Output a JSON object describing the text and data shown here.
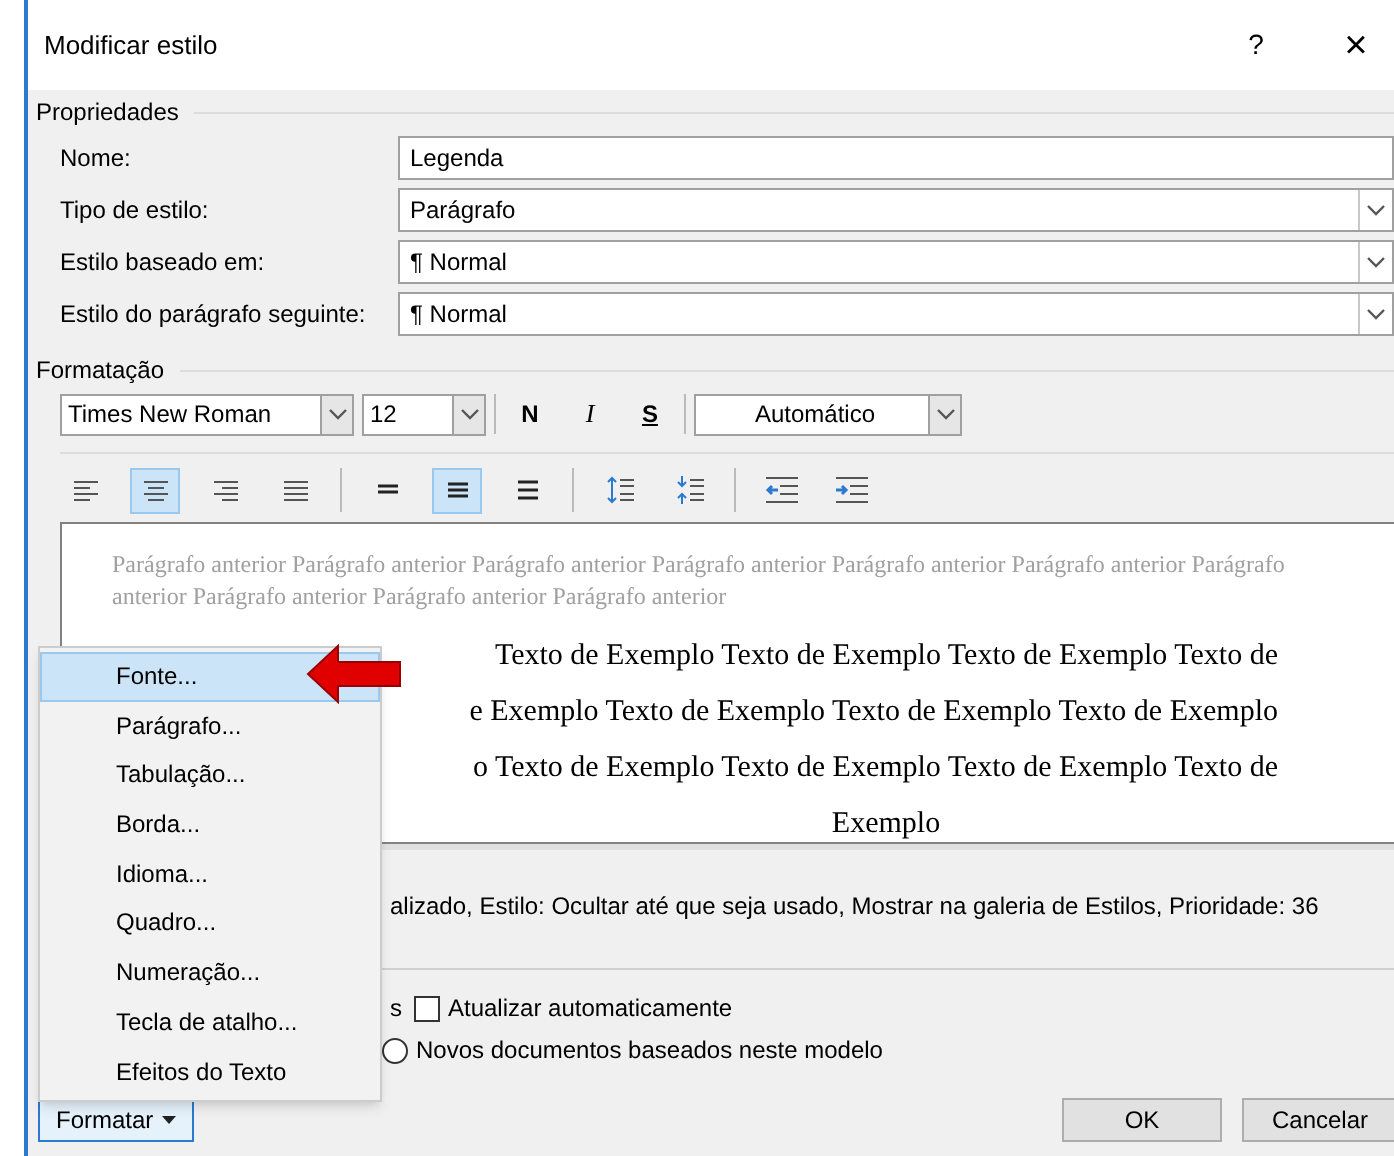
{
  "window": {
    "title": "Modificar estilo",
    "help": "?",
    "close": "×"
  },
  "properties": {
    "heading": "Propriedades",
    "rows": [
      {
        "label": "Nome:",
        "value": "Legenda",
        "kind": "text"
      },
      {
        "label": "Tipo de estilo:",
        "value": "Parágrafo",
        "kind": "dropdown"
      },
      {
        "label": "Estilo baseado em:",
        "value": "¶ Normal",
        "kind": "dropdown"
      },
      {
        "label": "Estilo do parágrafo seguinte:",
        "value": "¶ Normal",
        "kind": "dropdown"
      }
    ]
  },
  "formatting": {
    "heading": "Formatação",
    "font": "Times New Roman",
    "size": "12",
    "bold": "N",
    "italic": "I",
    "underline": "S",
    "font_color_text": "Automático",
    "alignment": [
      {
        "kind": "left",
        "selected": false
      },
      {
        "kind": "center",
        "selected": true
      },
      {
        "kind": "right",
        "selected": false
      },
      {
        "kind": "justify",
        "selected": false
      }
    ],
    "spacing": [
      {
        "kind": "single",
        "selected": false
      },
      {
        "kind": "onehalf",
        "selected": true
      },
      {
        "kind": "double",
        "selected": false
      }
    ],
    "indent": [
      {
        "kind": "space-before"
      },
      {
        "kind": "space-after"
      },
      {
        "kind": "outdent"
      },
      {
        "kind": "indent"
      }
    ]
  },
  "preview": {
    "previous": "Parágrafo anterior Parágrafo anterior Parágrafo anterior Parágrafo anterior Parágrafo anterior Parágrafo anterior Parágrafo anterior Parágrafo anterior Parágrafo anterior Parágrafo anterior",
    "sample_lines": [
      "Texto de Exemplo Texto de Exemplo Texto de Exemplo Texto de",
      "e Exemplo Texto de Exemplo Texto de Exemplo Texto de Exemplo",
      "o Texto de Exemplo Texto de Exemplo Texto de Exemplo Texto de",
      "Exemplo"
    ]
  },
  "description": "alizado, Estilo: Ocultar até que seja usado, Mostrar na galeria de Estilos, Prioridade: 36",
  "options": {
    "partial_label": "s",
    "auto_update": {
      "label": "Atualizar automaticamente",
      "checked": false
    },
    "new_docs": {
      "label": "Novos documentos baseados neste modelo",
      "selected": false
    }
  },
  "menu": {
    "items": [
      {
        "label": "Fonte...",
        "selected": true
      },
      {
        "label": "Parágrafo...",
        "selected": false
      },
      {
        "label": "Tabulação...",
        "selected": false
      },
      {
        "label": "Borda...",
        "selected": false
      },
      {
        "label": "Idioma...",
        "selected": false
      },
      {
        "label": "Quadro...",
        "selected": false
      },
      {
        "label": "Numeração...",
        "selected": false
      },
      {
        "label": "Tecla de atalho...",
        "selected": false
      },
      {
        "label": "Efeitos do Texto",
        "selected": false
      }
    ]
  },
  "buttons": {
    "format": "Formatar",
    "ok": "OK",
    "cancel": "Cancelar"
  }
}
